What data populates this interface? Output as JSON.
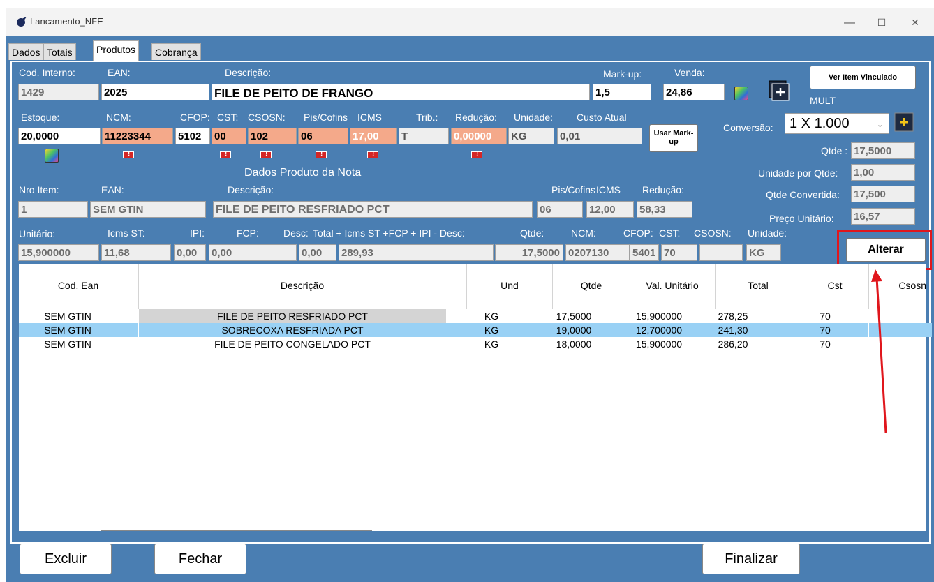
{
  "window": {
    "title": "Lancamento_NFE",
    "minimize": "—",
    "maximize": "☐",
    "close": "✕"
  },
  "tabs": [
    "Dados",
    "Totais",
    "Produtos",
    "Cobrança"
  ],
  "product": {
    "labels": {
      "cod_interno": "Cod. Interno:",
      "ean": "EAN:",
      "descricao": "Descrição:",
      "markup": "Mark-up:",
      "venda": "Venda:",
      "estoque": "Estoque:",
      "ncm": "NCM:",
      "cfop": "CFOP:",
      "cst": "CST:",
      "csosn": "CSOSN:",
      "pis_cofins": "Pis/Cofins",
      "icms": "ICMS",
      "trib": "Trib.:",
      "reducao": "Redução:",
      "unidade": "Unidade:",
      "custo_atual": "Custo Atual",
      "conversao": "Conversão:",
      "qtde": "Qtde :",
      "unidade_por_qtde": "Unidade por Qtde:",
      "qtde_convertida": "Qtde Convertida:",
      "preco_unitario": "Preço Unitário:"
    },
    "values": {
      "cod_interno": "1429",
      "ean": "2025",
      "descricao": "FILE DE PEITO DE FRANGO",
      "markup": "1,5",
      "venda": "24,86",
      "estoque": "20,0000",
      "ncm": "11223344",
      "cfop": "5102",
      "cst": "00",
      "csosn": "102",
      "pis_cofins": "06",
      "icms": "17,00",
      "trib": "T",
      "reducao": "0,00000",
      "unidade": "KG",
      "custo_atual": "0,01",
      "conversao": "1 X 1.000",
      "qtde": "17,5000",
      "unidade_por_qtde": "1,00",
      "qtde_convertida": "17,500",
      "preco_unitario": "16,57"
    },
    "ver_item_vinculado": "Ver Item Vinculado",
    "mult": "MULT",
    "usar_markup": "Usar Mark-up"
  },
  "nota": {
    "section_title": "Dados Produto da Nota",
    "labels": {
      "nro_item": "Nro Item:",
      "ean": "EAN:",
      "descricao": "Descrição:",
      "pis_cofins": "Pis/Cofins",
      "icms": "ICMS",
      "reducao": "Redução:",
      "unitario": "Unitário:",
      "icms_st": "Icms ST:",
      "ipi": "IPI:",
      "fcp": "FCP:",
      "desc": "Desc:",
      "total": "Total + Icms ST +FCP + IPI - Desc:",
      "qtde": "Qtde:",
      "ncm": "NCM:",
      "cfop": "CFOP:",
      "cst": "CST:",
      "csosn": "CSOSN:",
      "unidade": "Unidade:"
    },
    "values": {
      "nro_item": "1",
      "ean": "SEM GTIN",
      "descricao": "FILE DE PEITO RESFRIADO  PCT",
      "pis_cofins": "06",
      "icms": "12,00",
      "reducao": "58,33",
      "unitario": "15,900000",
      "icms_st": "11,68",
      "ipi": "0,00",
      "fcp": "0,00",
      "desc": "0,00",
      "total": "289,93",
      "qtde": "17,5000",
      "ncm": "0207130",
      "cfop": "5401",
      "cst": "70",
      "csosn": "",
      "unidade": "KG"
    },
    "alterar": "Alterar"
  },
  "grid": {
    "headers": [
      "Cod. Ean",
      "Descrição",
      "Und",
      "Qtde",
      "Val. Unitário",
      "Total",
      "Cst",
      "Csosn"
    ],
    "rows": [
      [
        "SEM GTIN",
        "FILE DE PEITO RESFRIADO  PCT",
        "KG",
        "17,5000",
        "15,900000",
        "278,25",
        "70",
        ""
      ],
      [
        "SEM GTIN",
        "SOBRECOXA RESFRIADA  PCT",
        "KG",
        "19,0000",
        "12,700000",
        "241,30",
        "70",
        ""
      ],
      [
        "SEM GTIN",
        "FILE DE PEITO CONGELADO  PCT",
        "KG",
        "18,0000",
        "15,900000",
        "286,20",
        "70",
        ""
      ]
    ],
    "selected_row": 1
  },
  "buttons": {
    "excluir": "Excluir",
    "fechar": "Fechar",
    "finalizar": "Finalizar"
  },
  "colors": {
    "panel": "#4a7eb2",
    "selected_row": "#99d1f5",
    "field_error": "#f4a98a",
    "highlight": "#e0161c"
  }
}
